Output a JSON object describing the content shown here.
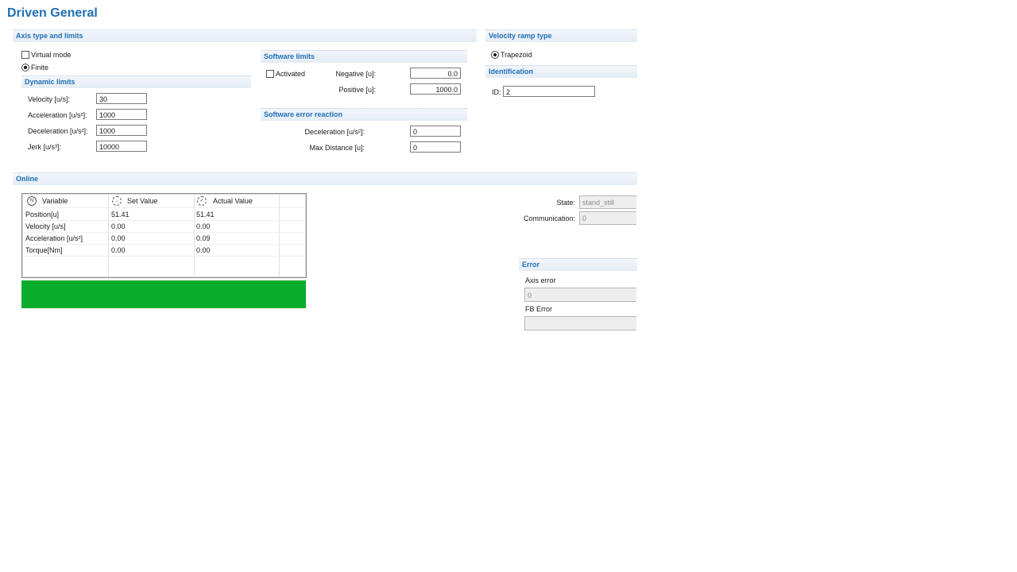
{
  "page_title": "Driven General",
  "axis_section": {
    "header": "Axis type and limits",
    "virtual_mode_label": "Virtual mode",
    "virtual_mode_checked": false,
    "finite_label": "Finite",
    "finite_selected": true
  },
  "dynamic_limits": {
    "header": "Dynamic limits",
    "fields": [
      {
        "label": "Velocity [u/s]:",
        "value": "30"
      },
      {
        "label": "Acceleration [u/s²]:",
        "value": "1000"
      },
      {
        "label": "Deceleration [u/s²]:",
        "value": "1000"
      },
      {
        "label": "Jerk [u/s³]:",
        "value": "10000"
      }
    ]
  },
  "software_limits": {
    "header": "Software limits",
    "activated_label": "Activated",
    "activated_checked": false,
    "negative_label": "Negative [u]:",
    "negative_value": "0.0",
    "positive_label": "Positive [u]:",
    "positive_value": "1000.0"
  },
  "software_error_reaction": {
    "header": "Software error reaction",
    "deceleration_label": "Deceleration [u/s²]:",
    "deceleration_value": "0",
    "max_distance_label": "Max Distance [u]:",
    "max_distance_value": "0"
  },
  "velocity_ramp": {
    "header": "Velocity ramp type",
    "option_label": "Trapezoid",
    "option_selected": true
  },
  "identification": {
    "header": "Identification",
    "id_label": "ID:",
    "id_value": "2"
  },
  "online": {
    "header": "Online",
    "columns": [
      {
        "icon": "N",
        "label": "Variable"
      },
      {
        "icon": "set-value-gauge-icon",
        "label": "Set Value"
      },
      {
        "icon": "actual-value-gauge-icon",
        "label": "Actual Value"
      }
    ],
    "rows": [
      {
        "variable": "Position[u]",
        "set": "51.41",
        "actual": "51.41"
      },
      {
        "variable": "Velocity [u/s]",
        "set": "0.00",
        "actual": "0.00"
      },
      {
        "variable": "Acceleration [u/s²]",
        "set": "0.00",
        "actual": "0.09"
      },
      {
        "variable": "Torque[Nm]",
        "set": "0.00",
        "actual": "0.00"
      }
    ],
    "status_bar_color": "#0aad2b",
    "state_label": "State:",
    "state_value": "stand_still",
    "communication_label": "Communication:",
    "communication_value": "0"
  },
  "error": {
    "header": "Error",
    "axis_error_label": "Axis error",
    "axis_error_value": "0",
    "fb_error_label": "FB Error",
    "fb_error_value": ""
  },
  "colors": {
    "accent": "#1f6fb5",
    "status_ok": "#0aad2b"
  }
}
